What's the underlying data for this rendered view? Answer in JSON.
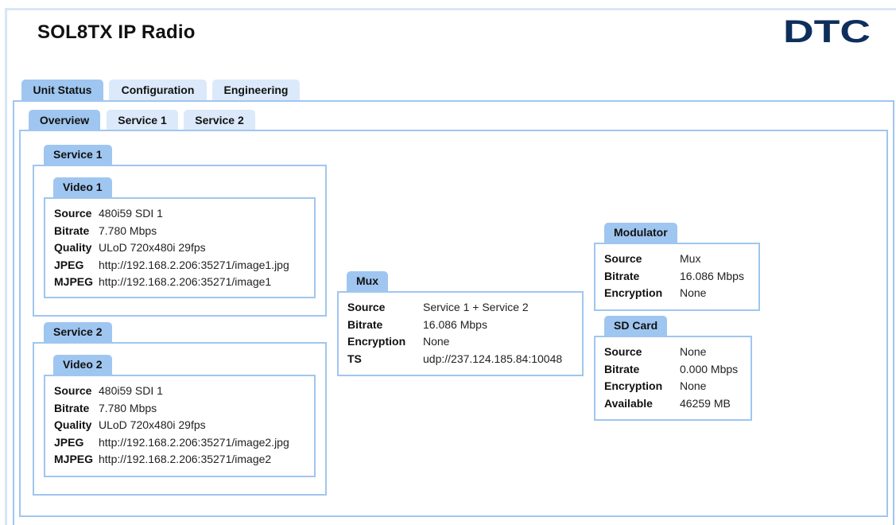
{
  "app": {
    "title": "SOL8TX IP Radio",
    "logo_text": "DTC"
  },
  "main_tabs": [
    "Unit Status",
    "Configuration",
    "Engineering"
  ],
  "sub_tabs": [
    "Overview",
    "Service 1",
    "Service 2"
  ],
  "service1": {
    "label": "Service 1",
    "video": {
      "label": "Video 1",
      "source_label": "Source",
      "source": "480i59 SDI 1",
      "bitrate_label": "Bitrate",
      "bitrate": "7.780 Mbps",
      "quality_label": "Quality",
      "quality": "ULoD 720x480i 29fps",
      "jpeg_label": "JPEG",
      "jpeg": "http://192.168.2.206:35271/image1.jpg",
      "mjpeg_label": "MJPEG",
      "mjpeg": "http://192.168.2.206:35271/image1"
    }
  },
  "service2": {
    "label": "Service 2",
    "video": {
      "label": "Video 2",
      "source_label": "Source",
      "source": "480i59 SDI 1",
      "bitrate_label": "Bitrate",
      "bitrate": "7.780 Mbps",
      "quality_label": "Quality",
      "quality": "ULoD 720x480i 29fps",
      "jpeg_label": "JPEG",
      "jpeg": "http://192.168.2.206:35271/image2.jpg",
      "mjpeg_label": "MJPEG",
      "mjpeg": "http://192.168.2.206:35271/image2"
    }
  },
  "mux": {
    "label": "Mux",
    "source_label": "Source",
    "source": "Service 1 + Service 2",
    "bitrate_label": "Bitrate",
    "bitrate": "16.086 Mbps",
    "encryption_label": "Encryption",
    "encryption": "None",
    "ts_label": "TS",
    "ts": "udp://237.124.185.84:10048"
  },
  "modulator": {
    "label": "Modulator",
    "source_label": "Source",
    "source": "Mux",
    "bitrate_label": "Bitrate",
    "bitrate": "16.086 Mbps",
    "encryption_label": "Encryption",
    "encryption": "None"
  },
  "sdcard": {
    "label": "SD Card",
    "source_label": "Source",
    "source": "None",
    "bitrate_label": "Bitrate",
    "bitrate": "0.000 Mbps",
    "encryption_label": "Encryption",
    "encryption": "None",
    "available_label": "Available",
    "available": "46259 MB"
  },
  "colors": {
    "accent": "#9fc6f0",
    "tab_inactive": "#dbe9fa",
    "logo": "#0e2f5c"
  }
}
